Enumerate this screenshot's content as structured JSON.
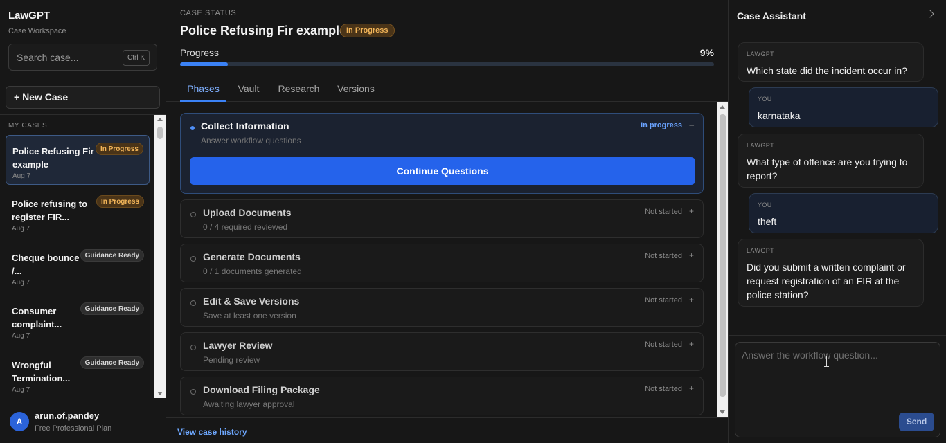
{
  "sidebar": {
    "app_title": "LawGPT",
    "app_subtitle": "Case Workspace",
    "search_placeholder": "Search case...",
    "search_shortcut": "Ctrl K",
    "new_case_label": "+ New Case",
    "section_label": "MY CASES",
    "cases": [
      {
        "title": "Police Refusing Fir example",
        "status": "In Progress",
        "date": "Aug 7",
        "active": true
      },
      {
        "title": "Police refusing to register FIR...",
        "status": "In Progress",
        "date": "Aug 7"
      },
      {
        "title": "Cheque bounce /...",
        "status": "Guidance Ready",
        "date": "Aug 7"
      },
      {
        "title": "Consumer complaint...",
        "status": "Guidance Ready",
        "date": "Aug 7"
      },
      {
        "title": "Wrongful Termination...",
        "status": "Guidance Ready",
        "date": "Aug 7"
      }
    ],
    "user": {
      "initial": "A",
      "name": "arun.of.pandey",
      "plan": "Free Professional Plan"
    }
  },
  "main": {
    "case_status_label": "CASE STATUS",
    "case_title": "Police Refusing Fir example",
    "case_badge": "In Progress",
    "progress_label": "Progress",
    "progress_text": "9%",
    "progress_value": 0.09,
    "tabs": [
      {
        "label": "Phases",
        "active": true
      },
      {
        "label": "Vault"
      },
      {
        "label": "Research"
      },
      {
        "label": "Versions"
      }
    ],
    "phases": [
      {
        "title": "Collect Information",
        "subtitle": "Answer workflow questions",
        "status": "In progress",
        "toggle": "–",
        "action": "Continue Questions",
        "active": true
      },
      {
        "title": "Upload Documents",
        "subtitle": "0 / 4 required reviewed",
        "status": "Not started",
        "toggle": "+"
      },
      {
        "title": "Generate Documents",
        "subtitle": "0 / 1 documents generated",
        "status": "Not started",
        "toggle": "+"
      },
      {
        "title": "Edit & Save Versions",
        "subtitle": "Save at least one version",
        "status": "Not started",
        "toggle": "+"
      },
      {
        "title": "Lawyer Review",
        "subtitle": "Pending review",
        "status": "Not started",
        "toggle": "+"
      },
      {
        "title": "Download Filing Package",
        "subtitle": "Awaiting lawyer approval",
        "status": "Not started",
        "toggle": "+"
      }
    ],
    "history_link": "View case history"
  },
  "assistant": {
    "title": "Case Assistant",
    "messages": [
      {
        "role": "LAWGPT",
        "text": "Which state did the incident occur in?"
      },
      {
        "role": "YOU",
        "text": "karnataka"
      },
      {
        "role": "LAWGPT",
        "text": "What type of offence are you trying to report?"
      },
      {
        "role": "YOU",
        "text": "theft"
      },
      {
        "role": "LAWGPT",
        "text": "Did you submit a written complaint or request registration of an FIR at the police station?"
      }
    ],
    "input_placeholder": "Answer the workflow question...",
    "send_label": "Send"
  },
  "colors": {
    "accent": "#2563eb",
    "in_progress": "#f2b559",
    "link": "#6ea8ff"
  }
}
